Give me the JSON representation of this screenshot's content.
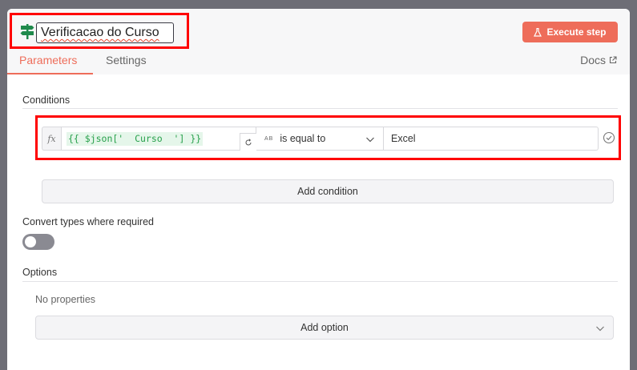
{
  "node": {
    "name": "Verificacao do Curso"
  },
  "header": {
    "execute_label": "Execute step",
    "docs_label": "Docs"
  },
  "tabs": [
    {
      "label": "Parameters"
    },
    {
      "label": "Settings"
    }
  ],
  "conditions": {
    "title": "Conditions",
    "fx_label": "fx",
    "row": {
      "left_value": "{{ $json['  Curso  '] }}",
      "type_badge": "AB",
      "operator": "is equal to",
      "right_value": "Excel"
    },
    "add_label": "Add condition"
  },
  "convert_types": {
    "label": "Convert types where required",
    "enabled": false
  },
  "options": {
    "title": "Options",
    "empty_text": "No properties",
    "add_label": "Add option"
  },
  "colors": {
    "accent": "#ee6d5a",
    "highlight": "#ff0000",
    "expression_text": "#27a04b"
  }
}
